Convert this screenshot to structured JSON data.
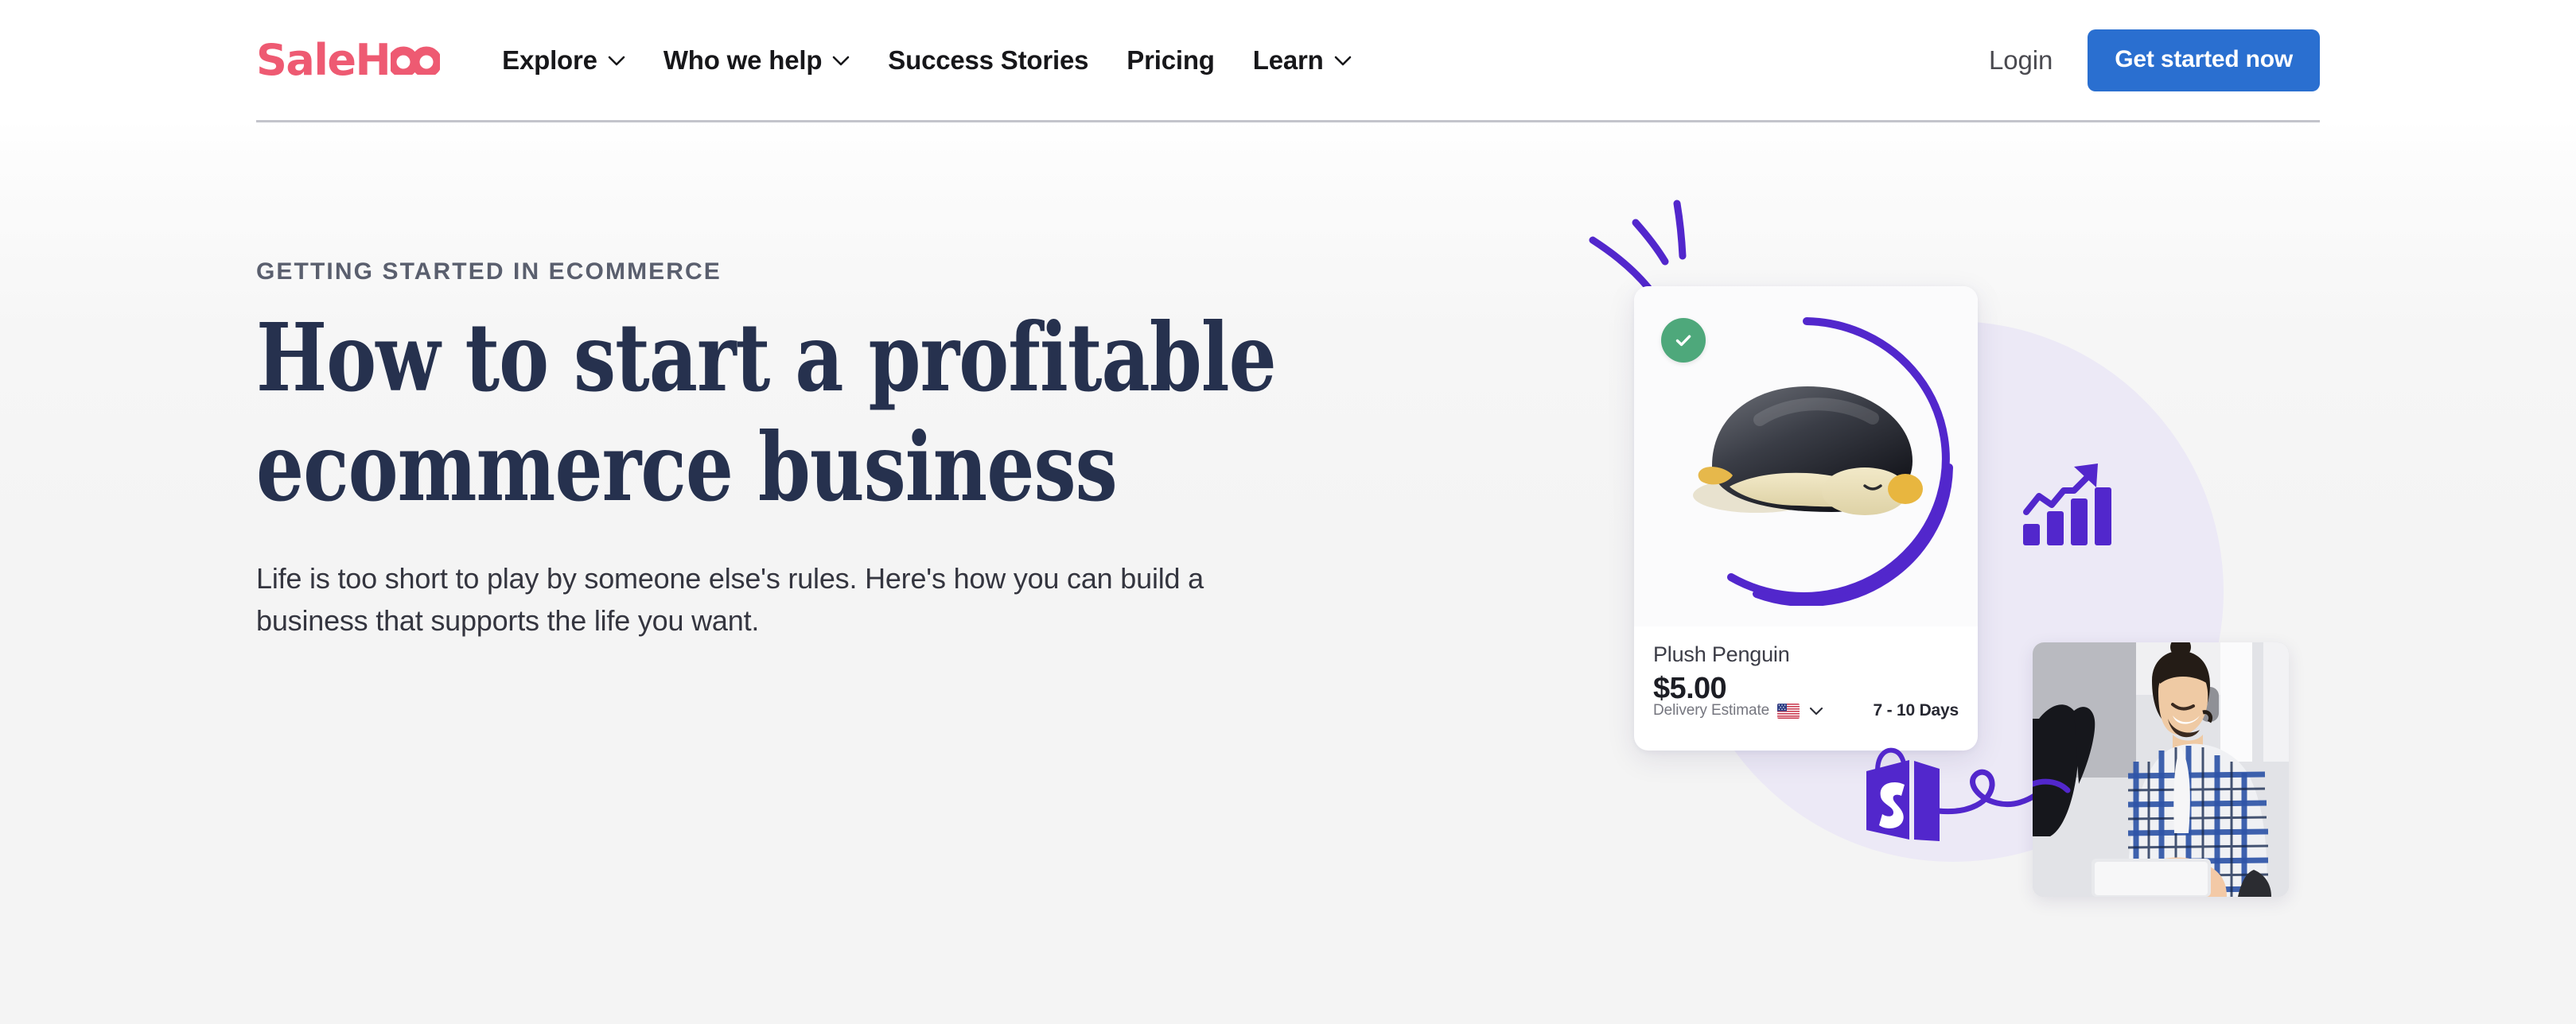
{
  "brand": {
    "logo_text": "SaleH",
    "logo_suffix": "oo",
    "logo_color": "#ee5a72"
  },
  "header": {
    "nav_items": [
      {
        "label": "Explore",
        "has_dropdown": true,
        "icon": "chevron-down-icon"
      },
      {
        "label": "Who we help",
        "has_dropdown": true,
        "icon": "chevron-down-icon"
      },
      {
        "label": "Success Stories",
        "has_dropdown": false
      },
      {
        "label": "Pricing",
        "has_dropdown": false
      },
      {
        "label": "Learn",
        "has_dropdown": true,
        "icon": "chevron-down-icon"
      }
    ],
    "login_label": "Login",
    "cta_label": "Get started now",
    "cta_color": "#2a6fd0"
  },
  "hero": {
    "eyebrow": "GETTING STARTED IN ECOMMERCE",
    "title": "How to start a profitable ecommerce business",
    "subtitle": "Life is too short to play by someone else's rules. Here's how you can build a business that supports the life you want.",
    "title_color": "#26314e"
  },
  "illustration": {
    "accent_purple": "#5227cc",
    "lavender_circle": "#ece9f6",
    "badge": {
      "icon": "check-icon",
      "color": "#4ea87b"
    },
    "product_card": {
      "title": "Plush Penguin",
      "price": "$5.00",
      "delivery_label": "Delivery Estimate",
      "delivery_country_icon": "us-flag-icon",
      "delivery_dropdown_icon": "chevron-down-icon",
      "delivery_value": "7 - 10 Days",
      "product_image": "plush-penguin-photo"
    },
    "growth_chart_icon": "growth-chart-icon",
    "shopify_icon": "shopify-bag-icon",
    "squiggle_icon": "squiggle-arrow-icon",
    "person_photo": "man-at-laptop-photo"
  }
}
